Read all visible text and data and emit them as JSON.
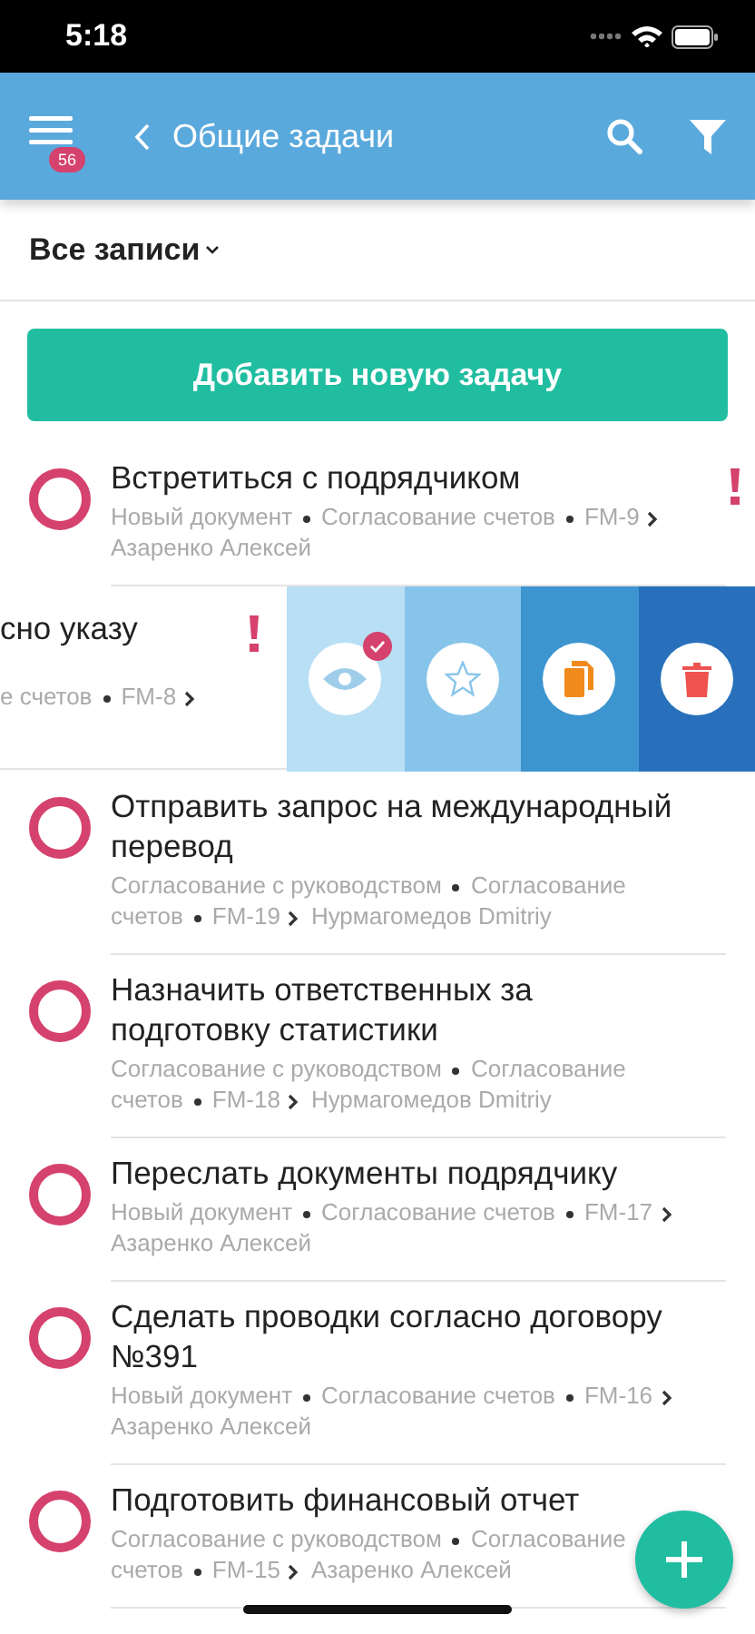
{
  "status_bar": {
    "time": "5:18"
  },
  "header": {
    "menu_badge": "56",
    "title": "Общие задачи"
  },
  "filter": {
    "label": "Все записи"
  },
  "add_button": {
    "label": "Добавить новую задачу"
  },
  "tasks": [
    {
      "kind": "task",
      "title": "Встретиться с подрядчиком",
      "stage": "Новый документ",
      "process": "Согласование счетов",
      "code": "FM-9",
      "assignee": "Азаренко Алексей",
      "urgent": true
    },
    {
      "kind": "swiped",
      "title": "сно указу",
      "process": "е счетов",
      "code": "FM-8",
      "urgent": true,
      "actions": [
        {
          "kind": "watch",
          "color": "#b9dff5",
          "checked": true
        },
        {
          "kind": "favorite",
          "color": "#87c4ea",
          "checked": false
        },
        {
          "kind": "copy",
          "color": "#3d95d0",
          "checked": false
        },
        {
          "kind": "delete",
          "color": "#2870bb",
          "checked": false
        }
      ]
    },
    {
      "kind": "task",
      "title": "Отправить запрос на международный перевод",
      "stage": "Согласование с руководством",
      "process": "Согласование счетов",
      "code": "FM-19",
      "assignee": "Нурмагомедов Dmitriy",
      "urgent": false
    },
    {
      "kind": "task",
      "title": "Назначить ответственных за подготовку статистики",
      "stage": "Согласование с руководством",
      "process": "Согласование счетов",
      "code": "FM-18",
      "assignee": "Нурмагомедов Dmitriy",
      "urgent": false
    },
    {
      "kind": "task",
      "title": "Переслать документы подрядчику",
      "stage": "Новый документ",
      "process": "Согласование счетов",
      "code": "FM-17",
      "assignee": "Азаренко Алексей",
      "urgent": false
    },
    {
      "kind": "task",
      "title": "Сделать проводки согласно договору №391",
      "stage": "Новый документ",
      "process": "Согласование счетов",
      "code": "FM-16",
      "assignee": "Азаренко Алексей",
      "urgent": false
    },
    {
      "kind": "task",
      "title": "Подготовить финансовый отчет",
      "stage": "Согласование с руководством",
      "process": "Согласование счетов",
      "code": "FM-15",
      "assignee": "Азаренко Алексей",
      "urgent": false
    }
  ]
}
